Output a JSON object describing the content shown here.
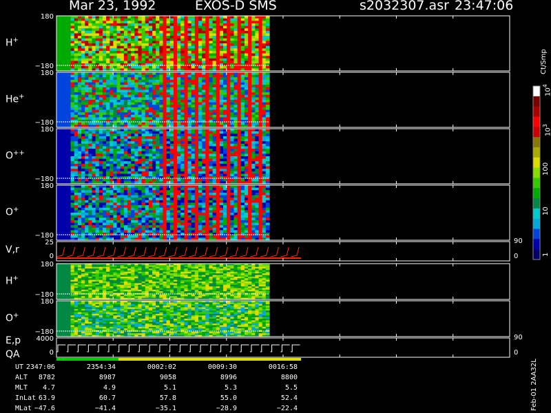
{
  "header": {
    "date": "Mar 23, 1992",
    "instrument": "EXOS-D SMS",
    "file": "s2032307.asr",
    "time": "23:47:06"
  },
  "colorbar": {
    "unit": "Ct/Smp",
    "tick_labels": [
      "1",
      "10",
      "100",
      "10",
      "10"
    ],
    "tick_exponents": [
      "",
      "",
      "",
      "3",
      "4"
    ],
    "colors": [
      "#000066",
      "#0000aa",
      "#0044dd",
      "#00aadd",
      "#00cccc",
      "#008844",
      "#00aa00",
      "#33cc00",
      "#88dd00",
      "#dddd00",
      "#aaaa00",
      "#887700",
      "#cc0000",
      "#ff0000",
      "#aa0000",
      "#770000",
      "#ffffff"
    ]
  },
  "footer_right": "Feb-01 2AA32L",
  "chart_data": [
    {
      "type": "heatmap",
      "panel": "H+ pitch angle",
      "label": "H",
      "label_sup": "+",
      "ylim": [
        -180,
        180
      ],
      "tick_labels": [
        "180",
        "−180"
      ],
      "data_extent_fraction": 0.47,
      "colors": [
        "#00aa00",
        "#33cc00",
        "#88dd00",
        "#dddd00",
        "#ff0000",
        "#aa0000",
        "#00cccc"
      ]
    },
    {
      "type": "heatmap",
      "panel": "He+ pitch angle",
      "label": "He",
      "label_sup": "+",
      "ylim": [
        -180,
        180
      ],
      "tick_labels": [
        "180",
        "−180"
      ],
      "data_extent_fraction": 0.47,
      "colors": [
        "#0044dd",
        "#00aadd",
        "#00cccc",
        "#008844",
        "#00aa00",
        "#33cc00",
        "#ff0000"
      ]
    },
    {
      "type": "heatmap",
      "panel": "O++ pitch angle",
      "label": "O",
      "label_sup": "++",
      "ylim": [
        -180,
        180
      ],
      "tick_labels": [
        "180",
        "−180"
      ],
      "data_extent_fraction": 0.47,
      "colors": [
        "#0000aa",
        "#0044dd",
        "#00aadd",
        "#00cccc",
        "#008844",
        "#00aa00",
        "#ff0000"
      ]
    },
    {
      "type": "heatmap",
      "panel": "O+ pitch angle",
      "label": "O",
      "label_sup": "+",
      "ylim": [
        -180,
        180
      ],
      "tick_labels": [
        "180",
        "−180"
      ],
      "data_extent_fraction": 0.47,
      "colors": [
        "#0000aa",
        "#0044dd",
        "#00aadd",
        "#00cccc",
        "#008844",
        "#00aa00",
        "#ff0000"
      ]
    },
    {
      "type": "line",
      "panel": "V,r",
      "label": "V,r",
      "ylim": [
        0,
        25
      ],
      "tick_labels": [
        "25",
        "0"
      ],
      "right_labels": [
        "90",
        "0"
      ],
      "cycles": 24
    },
    {
      "type": "heatmap",
      "panel": "H+ second",
      "label": "H",
      "label_sup": "+",
      "ylim": [
        -180,
        180
      ],
      "tick_labels": [
        "180",
        "−180"
      ],
      "data_extent_fraction": 0.47,
      "colors": [
        "#008844",
        "#00aa00",
        "#33cc00",
        "#88dd00",
        "#dddd00"
      ]
    },
    {
      "type": "heatmap",
      "panel": "O+ second",
      "label": "O",
      "label_sup": "+",
      "ylim": [
        -180,
        180
      ],
      "tick_labels": [
        "180",
        "−180"
      ],
      "data_extent_fraction": 0.47,
      "colors": [
        "#008844",
        "#00aa00",
        "#33cc00",
        "#88dd00",
        "#dddd00",
        "#00aadd"
      ]
    },
    {
      "type": "line",
      "panel": "E,p QA",
      "label": "E,p",
      "label2": "QA",
      "ylim": [
        0,
        4000
      ],
      "tick_labels": [
        "4000",
        "0"
      ],
      "right_labels": [
        "90",
        "0"
      ],
      "cycles": 24
    }
  ],
  "ephemeris": {
    "labels": [
      "UT",
      "ALT",
      "MLT",
      "InLat",
      "MLat"
    ],
    "columns": [
      [
        "2347:06",
        "8782",
        "4.7",
        "63.9",
        "−47.6"
      ],
      [
        "2354:34",
        "8987",
        "4.9",
        "60.7",
        "−41.4"
      ],
      [
        "0002:02",
        "9058",
        "5.1",
        "57.8",
        "−35.1"
      ],
      [
        "0009:30",
        "8996",
        "5.3",
        "55.0",
        "−28.9"
      ],
      [
        "0016:58",
        "8800",
        "5.5",
        "52.4",
        "−22.4"
      ]
    ]
  }
}
